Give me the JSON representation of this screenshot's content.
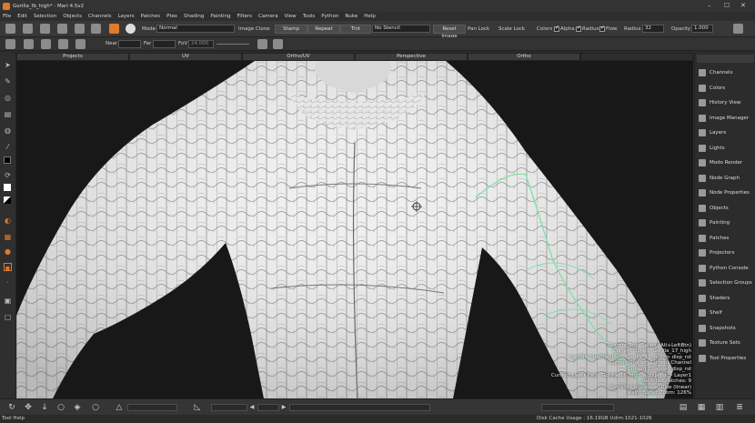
{
  "window": {
    "title": "Gorilla_fb_high* - Mari 4.5v2",
    "controls": [
      "–",
      "☐",
      "✕"
    ]
  },
  "menu": [
    "File",
    "Edit",
    "Selection",
    "Objects",
    "Channels",
    "Layers",
    "Patches",
    "Ptex",
    "Shading",
    "Painting",
    "Filters",
    "Camera",
    "View",
    "Tools",
    "Python",
    "Nuke",
    "Help"
  ],
  "toolbar": {
    "mode_label": "Mode",
    "mode_value": "Normal",
    "image_clone_label": "Image Clone",
    "stamp_label": "Stamp",
    "repeat_label": "Repeat",
    "tint_label": "Tint",
    "stencil_value": "No Stencil",
    "reset_image_label": "Reset Image",
    "pan_lock_label": "Pan Lock",
    "scale_lock_label": "Scale Lock",
    "colors_label": "Colors",
    "alpha_label": "Alpha",
    "radius_label": "Radius",
    "flow_label": "Flow",
    "radius2_label": "Radius",
    "radius_value": "32",
    "opacity_label": "Opacity",
    "opacity_value": "1.000",
    "near_label": "Near",
    "far_label": "Far",
    "fov_label": "FoV",
    "fov_value": "24.000"
  },
  "tabs": [
    "Projects",
    "UV",
    "Ortho/UV",
    "Perspective",
    "Ortho"
  ],
  "right_panel": [
    "Channels",
    "Colors",
    "History View",
    "Image Manager",
    "Layers",
    "Lights",
    "Modo Render",
    "Node Graph",
    "Node Properties",
    "Objects",
    "Painting",
    "Patches",
    "Projectors",
    "Python Console",
    "Selection Groups",
    "Shaders",
    "Shelf",
    "Snapshots",
    "Texture Sets",
    "Tool Properties"
  ],
  "info_lines": [
    "Current Tool: Select (Alt+LeftBtn)",
    "Current Object: Gorilla_17_high",
    "Current Channel Path: Gorilla_17_high > disp_rst",
    "Current Shader: Current Channel",
    "Current Channel: disp_rst",
    "Current Layer Path: Gorilla_16_high > disp_rst > Layer1",
    "Selected Patches: 9",
    "Current Colorspace: Raw (linear)",
    "Paint Buffer Zoom: 126%"
  ],
  "status": {
    "help": "Tool Help",
    "cache": "Disk Cache Usage : 16.19GB  Udim:1021-1026"
  }
}
